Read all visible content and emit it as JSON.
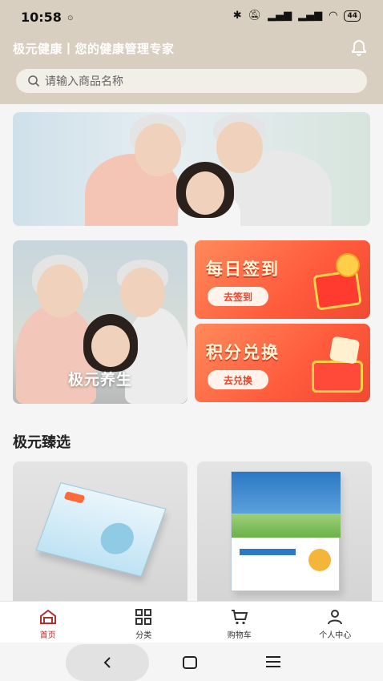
{
  "status_bar": {
    "time": "10:58",
    "battery": "44"
  },
  "header": {
    "title": "极元健康丨您的健康管理专家",
    "search_placeholder": "请输入商品名称"
  },
  "cards": {
    "left_label": "极元养生",
    "daily_signin": {
      "title": "每日签到",
      "button": "去签到"
    },
    "points_exchange": {
      "title": "积分兑换",
      "button": "去兑换"
    }
  },
  "section": {
    "title": "极元臻选"
  },
  "tabbar": {
    "items": [
      {
        "label": "首页",
        "icon": "home-icon",
        "active": true
      },
      {
        "label": "分类",
        "icon": "category-icon",
        "active": false
      },
      {
        "label": "购物车",
        "icon": "cart-icon",
        "active": false
      },
      {
        "label": "个人中心",
        "icon": "profile-icon",
        "active": false
      }
    ]
  },
  "colors": {
    "header_bg": "#d9cfc0",
    "accent": "#b03030",
    "promo": "#ff5a3c"
  }
}
